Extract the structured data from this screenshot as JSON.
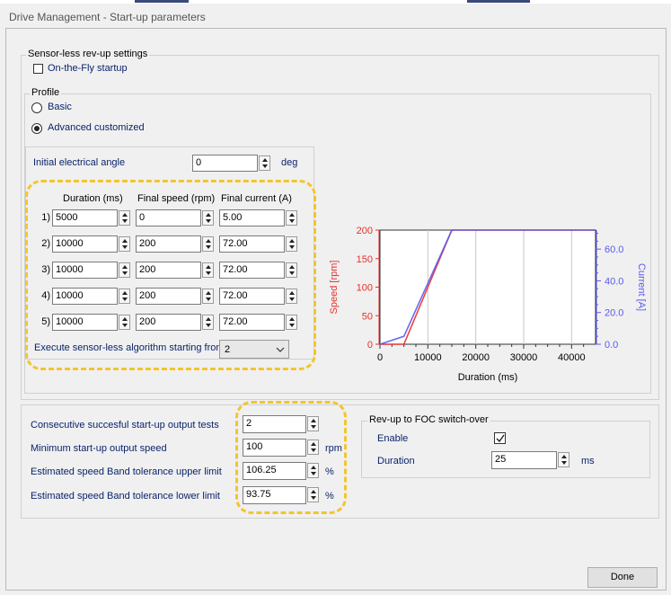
{
  "window": {
    "title": "Drive Management - Start-up parameters"
  },
  "sensorless": {
    "group_label": "Sensor-less rev-up settings",
    "on_the_fly": {
      "label": "On-the-Fly startup",
      "checked": false
    },
    "profile": {
      "group_label": "Profile",
      "options": [
        {
          "label": "Basic",
          "selected": false
        },
        {
          "label": "Advanced customized",
          "selected": true
        }
      ]
    },
    "initial_angle": {
      "label": "Initial electrical angle",
      "value": "0",
      "unit": "deg"
    },
    "table": {
      "headers": [
        "Duration (ms)",
        "Final speed (rpm)",
        "Final current (A)"
      ],
      "rows": [
        {
          "label": "1)",
          "duration": "5000",
          "speed": "0",
          "current": "5.00"
        },
        {
          "label": "2)",
          "duration": "10000",
          "speed": "200",
          "current": "72.00"
        },
        {
          "label": "3)",
          "duration": "10000",
          "speed": "200",
          "current": "72.00"
        },
        {
          "label": "4)",
          "duration": "10000",
          "speed": "200",
          "current": "72.00"
        },
        {
          "label": "5)",
          "duration": "10000",
          "speed": "200",
          "current": "72.00"
        }
      ]
    },
    "execute": {
      "label": "Execute sensor-less algorithm starting from",
      "value": "2"
    }
  },
  "startup_tests": {
    "fields": [
      {
        "label": "Consecutive succesful start-up output tests",
        "value": "2",
        "unit": ""
      },
      {
        "label": "Minimum start-up output speed",
        "value": "100",
        "unit": "rpm"
      },
      {
        "label": "Estimated speed Band tolerance upper limit",
        "value": "106.25",
        "unit": "%"
      },
      {
        "label": "Estimated speed Band tolerance lower limit",
        "value": "93.75",
        "unit": "%"
      }
    ]
  },
  "revup_foc": {
    "group_label": "Rev-up to FOC switch-over",
    "enable": {
      "label": "Enable",
      "checked": true
    },
    "duration": {
      "label": "Duration",
      "value": "25",
      "unit": "ms"
    }
  },
  "buttons": {
    "done": "Done"
  },
  "colors": {
    "speed": "#e8302a",
    "current": "#5a5af0",
    "highlight": "#f2c531",
    "label_blue": "#0a246a"
  },
  "chart_data": {
    "type": "line",
    "xlabel": "Duration (ms)",
    "ylabel_left": "Speed [rpm]",
    "ylabel_right": "Current [A]",
    "xlim": [
      0,
      45000
    ],
    "xticks": [
      "0",
      "10000",
      "20000",
      "30000",
      "40000"
    ],
    "xtick_values": [
      0,
      10000,
      20000,
      30000,
      40000
    ],
    "ylim_left": [
      0,
      200
    ],
    "yticks_left": [
      "0",
      "50",
      "100",
      "150",
      "200"
    ],
    "ylim_right": [
      0,
      72
    ],
    "yticks_right": [
      "0.0",
      "20.0",
      "40.0",
      "60.0"
    ],
    "series": [
      {
        "name": "Speed",
        "axis": "left",
        "x": [
          0,
          5000,
          15000,
          45000
        ],
        "y": [
          0,
          0,
          200,
          200
        ]
      },
      {
        "name": "Current",
        "axis": "right",
        "x": [
          0,
          5000,
          15000,
          45000
        ],
        "y": [
          0,
          5,
          72,
          72
        ]
      }
    ]
  }
}
